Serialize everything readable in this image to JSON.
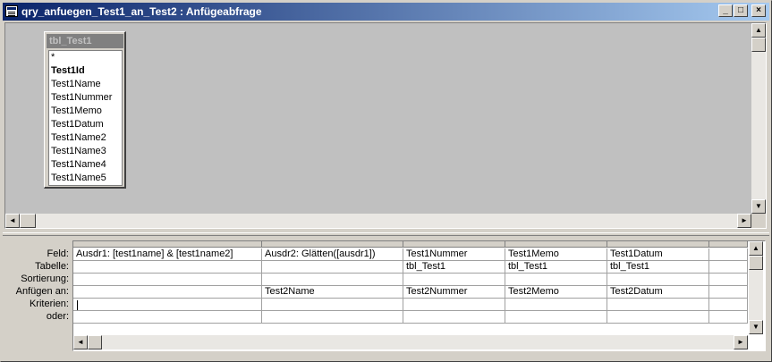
{
  "window": {
    "title": "qry_anfuegen_Test1_an_Test2 : Anfügeabfrage",
    "minimize_glyph": "_",
    "maximize_glyph": "□",
    "close_glyph": "×"
  },
  "table": {
    "name": "tbl_Test1",
    "fields": [
      "*",
      "Test1Id",
      "Test1Name",
      "Test1Nummer",
      "Test1Memo",
      "Test1Datum",
      "Test1Name2",
      "Test1Name3",
      "Test1Name4",
      "Test1Name5"
    ],
    "key_field": "Test1Id"
  },
  "grid": {
    "row_labels": [
      "Feld:",
      "Tabelle:",
      "Sortierung:",
      "Anfügen an:",
      "Kriterien:",
      "oder:"
    ],
    "columns": [
      {
        "feld": "Ausdr1: [test1name] & [test1name2]",
        "tabelle": "",
        "sortierung": "",
        "anfuegen": "",
        "kriterien": "",
        "oder": ""
      },
      {
        "feld": "Ausdr2: Glätten([ausdr1])",
        "tabelle": "",
        "sortierung": "",
        "anfuegen": "Test2Name",
        "kriterien": "",
        "oder": ""
      },
      {
        "feld": "Test1Nummer",
        "tabelle": "tbl_Test1",
        "sortierung": "",
        "anfuegen": "Test2Nummer",
        "kriterien": "",
        "oder": ""
      },
      {
        "feld": "Test1Memo",
        "tabelle": "tbl_Test1",
        "sortierung": "",
        "anfuegen": "Test2Memo",
        "kriterien": "",
        "oder": ""
      },
      {
        "feld": "Test1Datum",
        "tabelle": "tbl_Test1",
        "sortierung": "",
        "anfuegen": "Test2Datum",
        "kriterien": "",
        "oder": ""
      },
      {
        "feld": "",
        "tabelle": "",
        "sortierung": "",
        "anfuegen": "",
        "kriterien": "",
        "oder": ""
      }
    ]
  },
  "scroll": {
    "up": "▲",
    "down": "▼",
    "left": "◄",
    "right": "►"
  }
}
